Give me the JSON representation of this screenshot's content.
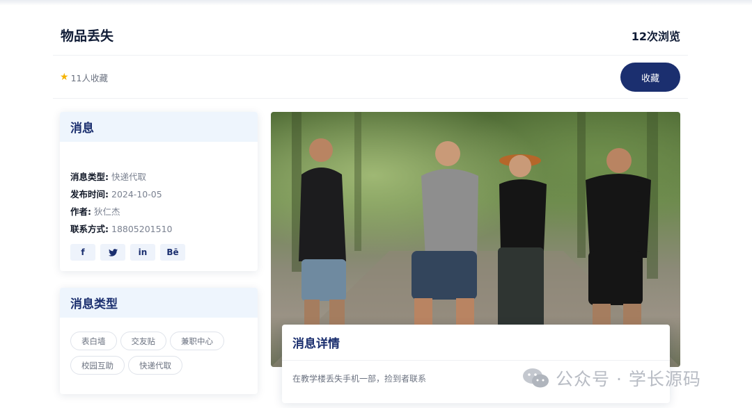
{
  "header": {
    "title": "物品丢失",
    "views": "12次浏览"
  },
  "favorites": {
    "count_label": "11人收藏",
    "button_label": "收藏"
  },
  "info": {
    "heading": "消息",
    "rows": [
      {
        "label": "消息类型:",
        "value": "快递代取"
      },
      {
        "label": "发布时间:",
        "value": "2024-10-05"
      },
      {
        "label": "作者:",
        "value": "狄仁杰"
      },
      {
        "label": "联系方式:",
        "value": "18805201510"
      }
    ],
    "socials": [
      {
        "icon": "facebook-icon",
        "glyph": "f"
      },
      {
        "icon": "twitter-icon",
        "glyph": "🐦"
      },
      {
        "icon": "linkedin-icon",
        "glyph": "in"
      },
      {
        "icon": "behance-icon",
        "glyph": "Bē"
      }
    ]
  },
  "types": {
    "heading": "消息类型",
    "tags": [
      "表白墙",
      "交友贴",
      "兼职中心",
      "校园互助",
      "快递代取"
    ]
  },
  "detail": {
    "heading": "消息详情",
    "text": "在教学楼丢失手机一部，捡到者联系"
  },
  "watermark": {
    "text": "公众号 · 学长源码"
  },
  "colors": {
    "primary": "#1b2f6f",
    "card_head_bg": "#eef5fd",
    "star": "#f5b301"
  }
}
